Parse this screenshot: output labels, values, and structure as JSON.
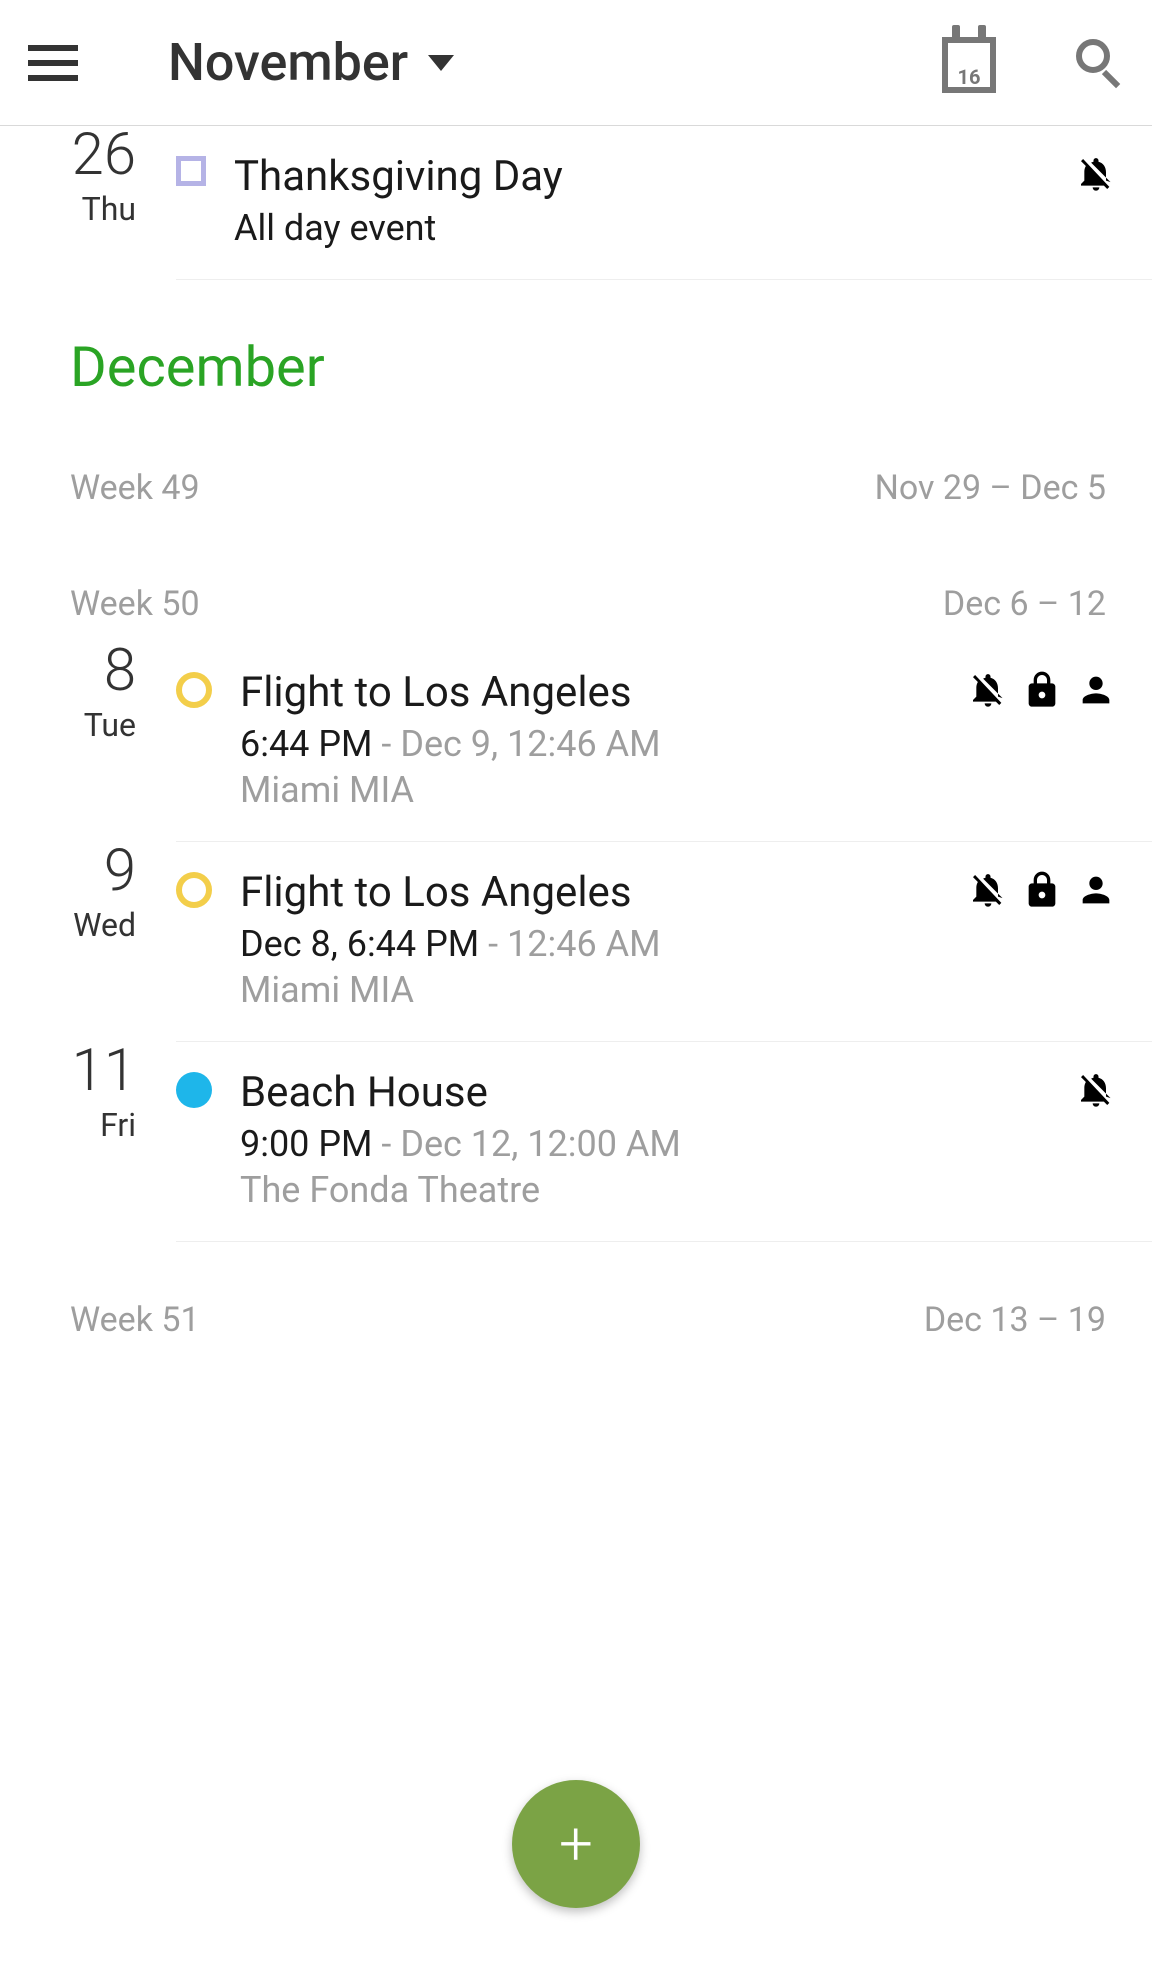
{
  "header": {
    "month_label": "November",
    "today_badge": "16"
  },
  "sections": [
    {
      "type": "event",
      "date_num": "26",
      "date_abbr": "Thu",
      "marker": "square",
      "title": "Thanksgiving Day",
      "time_primary": "All day event",
      "time_secondary": "",
      "location": "",
      "icons": [
        "bell-off"
      ]
    },
    {
      "type": "month",
      "label": "December"
    },
    {
      "type": "week",
      "week_label": "Week 49",
      "range": "Nov 29 – Dec 5"
    },
    {
      "type": "week",
      "week_label": "Week 50",
      "range": "Dec 6 – 12"
    },
    {
      "type": "event",
      "date_num": "8",
      "date_abbr": "Tue",
      "marker": "ring",
      "title": "Flight to Los Angeles",
      "time_primary": "6:44 PM",
      "time_secondary": "Dec 9, 12:46 AM",
      "location": "Miami MIA",
      "icons": [
        "bell-off",
        "lock",
        "person"
      ]
    },
    {
      "type": "event",
      "date_num": "9",
      "date_abbr": "Wed",
      "marker": "ring",
      "title": "Flight to Los Angeles",
      "time_primary": "Dec 8, 6:44 PM",
      "time_secondary": "12:46 AM",
      "location": "Miami MIA",
      "icons": [
        "bell-off",
        "lock",
        "person"
      ]
    },
    {
      "type": "event",
      "date_num": "11",
      "date_abbr": "Fri",
      "marker": "dot-blue",
      "title": "Beach House",
      "time_primary": "9:00 PM",
      "time_secondary": "Dec 12, 12:00 AM",
      "location": "The Fonda Theatre",
      "icons": [
        "bell-off"
      ]
    },
    {
      "type": "week",
      "week_label": "Week 51",
      "range": "Dec 13 – 19"
    }
  ]
}
